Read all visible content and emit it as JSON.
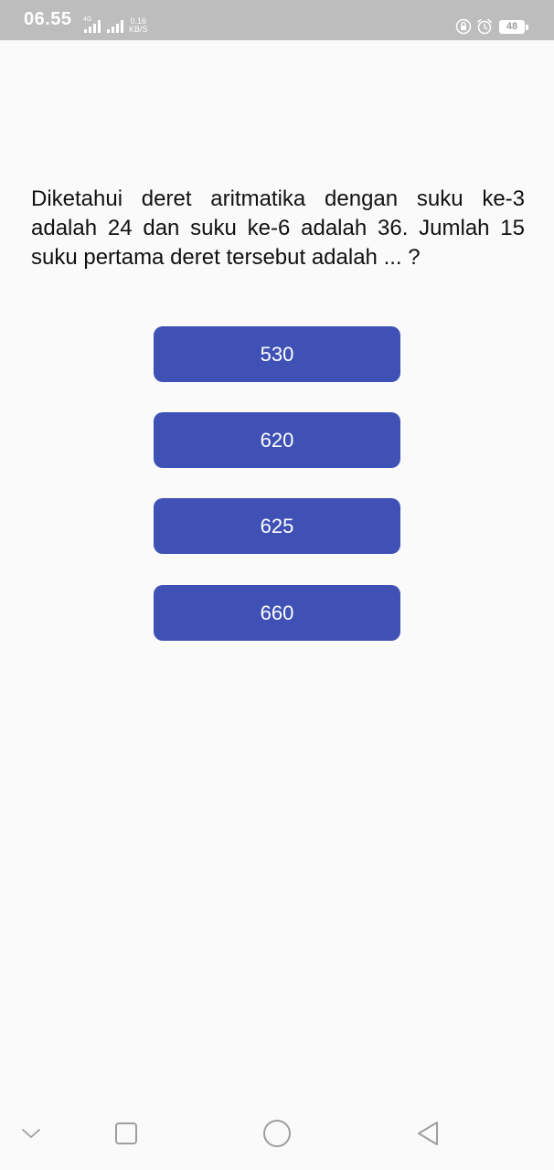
{
  "status_bar": {
    "time": "06.55",
    "network_type": "4G",
    "speed_value": "0.16",
    "speed_unit": "KB/S",
    "battery": "48",
    "icons": [
      "signal-icon",
      "signal-icon",
      "lock-rotation-icon",
      "alarm-icon",
      "battery-icon"
    ]
  },
  "question": {
    "text": "Diketahui deret aritmatika dengan suku ke-3 adalah 24 dan suku ke-6 adalah 36. Jumlah 15 suku pertama deret tersebut adalah ... ?"
  },
  "answers": [
    {
      "label": "530"
    },
    {
      "label": "620"
    },
    {
      "label": "625"
    },
    {
      "label": "660"
    }
  ],
  "nav_bar": {
    "icons": [
      "chevron-down-icon",
      "recent-apps-icon",
      "home-icon",
      "back-icon"
    ]
  },
  "colors": {
    "status_bar_bg": "#bdbdbd",
    "page_bg": "#fafafa",
    "button_bg": "#3f51b5",
    "button_text": "#ffffff",
    "question_text": "#111111",
    "nav_icon": "#9e9e9e"
  }
}
